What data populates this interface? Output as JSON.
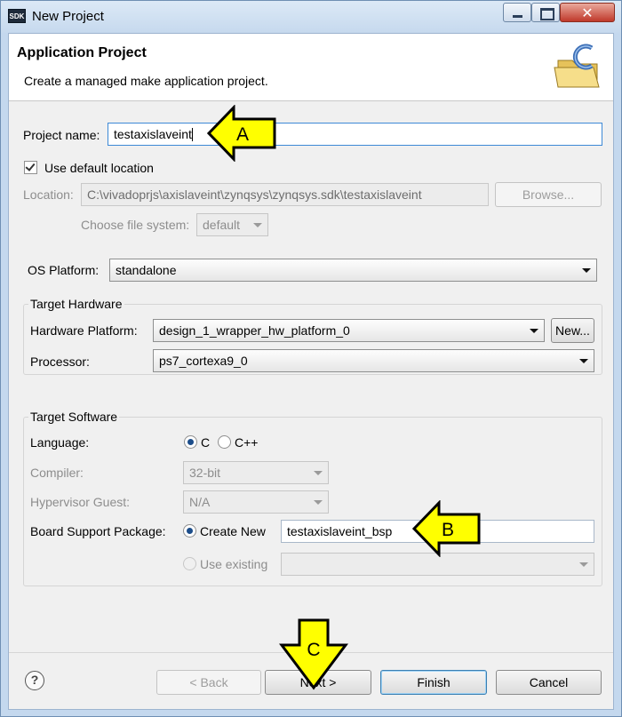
{
  "window": {
    "title": "New Project",
    "app_icon_text": "SDK",
    "close_glyph": "✕"
  },
  "banner": {
    "title": "Application Project",
    "description": "Create a managed make application project."
  },
  "project": {
    "name_label": "Project name:",
    "name_value": "testaxislaveint",
    "use_default_label": "Use default location",
    "use_default_checked": true,
    "location_label": "Location:",
    "location_value": "C:\\vivadoprjs\\axislaveint\\zynqsys\\zynqsys.sdk\\testaxislaveint",
    "browse_label": "Browse...",
    "filesystem_label": "Choose file system:",
    "filesystem_value": "default"
  },
  "os": {
    "label": "OS Platform:",
    "value": "standalone"
  },
  "hardware": {
    "title": "Target Hardware",
    "platform_label": "Hardware Platform:",
    "platform_value": "design_1_wrapper_hw_platform_0",
    "new_label": "New...",
    "processor_label": "Processor:",
    "processor_value": "ps7_cortexa9_0"
  },
  "software": {
    "title": "Target Software",
    "language_label": "Language:",
    "lang_c": "C",
    "lang_cpp": "C++",
    "selected_language": "C",
    "compiler_label": "Compiler:",
    "compiler_value": "32-bit",
    "hypervisor_label": "Hypervisor Guest:",
    "hypervisor_value": "N/A",
    "bsp_label": "Board Support Package:",
    "create_new_label": "Create New",
    "bsp_name": "testaxislaveint_bsp",
    "use_existing_label": "Use existing",
    "existing_value": ""
  },
  "annotations": {
    "a": "A",
    "b": "B",
    "c": "C",
    "color": "#ffff00"
  },
  "footer": {
    "help_glyph": "?",
    "back_label": "< Back",
    "next_label": "Next >",
    "finish_label": "Finish",
    "cancel_label": "Cancel"
  }
}
